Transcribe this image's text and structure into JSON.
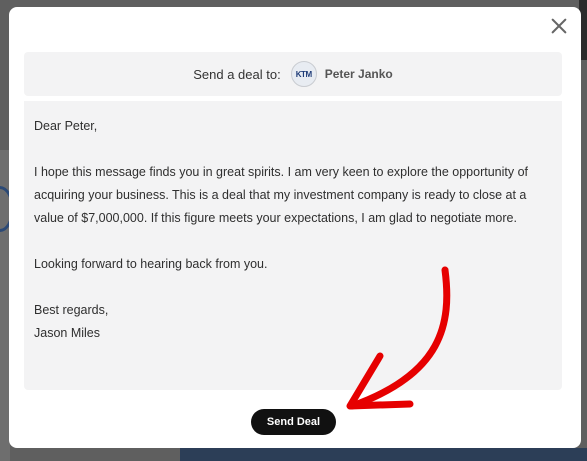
{
  "modal": {
    "header_label": "Send a deal to:",
    "recipient_name": "Peter Janko",
    "recipient_avatar_text": "KTM",
    "message": {
      "greeting": "Dear Peter,",
      "paragraph1": "I hope this message finds you in great spirits. I am very keen to explore the opportunity of acquiring your business. This is a deal that my investment company is ready to close at a value of $7,000,000. If this figure meets your expectations, I am glad to negotiate more.",
      "paragraph2": "Looking forward to hearing back from you.",
      "closing": "Best regards,",
      "signature": "Jason Miles"
    },
    "send_button_label": "Send Deal"
  },
  "annotation_color": "#e60000"
}
